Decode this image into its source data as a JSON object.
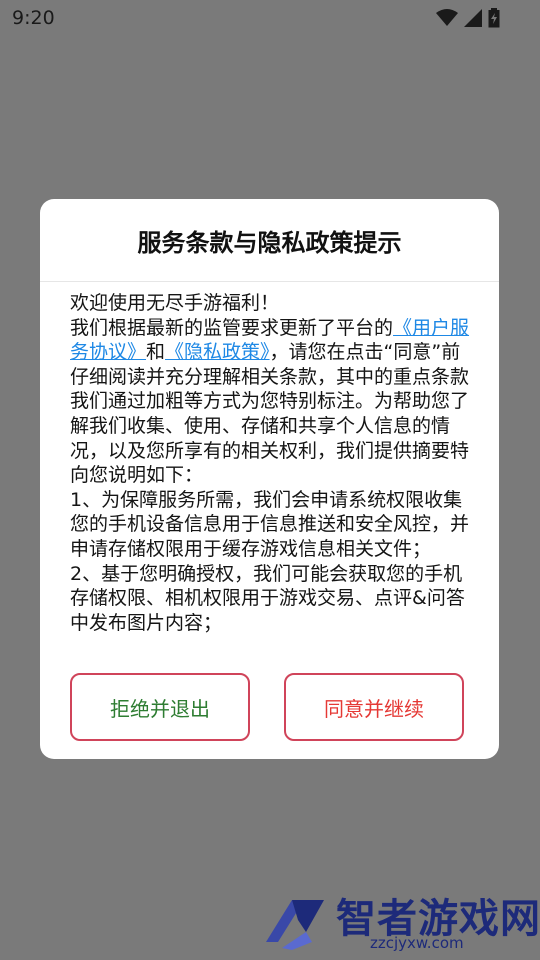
{
  "status_bar": {
    "time": "9:20",
    "icons": [
      "wifi-icon",
      "signal-icon",
      "battery-charging-icon"
    ]
  },
  "dialog": {
    "title": "服务条款与隐私政策提示",
    "greeting": "欢迎使用无尽手游福利！",
    "para1_before": "我们根据最新的监管要求更新了平台的",
    "link_user_agreement": "《用户服务协议》",
    "conjunction": "和",
    "link_privacy_policy": "《隐私政策》",
    "para1_after": "，请您在点击“同意”前仔细阅读并充分理解相关条款，其中的重点条款我们通过加粗等方式为您特别标注。为帮助您了解我们收集、使用、存储和共享个人信息的情况，以及您所享有的相关权利，我们提供摘要特向您说明如下：",
    "item1": "1、为保障服务所需，我们会申请系统权限收集您的手机设备信息用于信息推送和安全风控，并申请存储权限用于缓存游戏信息相关文件；",
    "item2": "2、基于您明确授权，我们可能会获取您的手机存储权限、相机权限用于游戏交易、点评&问答中发布图片内容；",
    "reject_label": "拒绝并退出",
    "agree_label": "同意并继续"
  },
  "watermark": {
    "brand": "智者游戏网",
    "url": "zzcjyxw.com"
  },
  "colors": {
    "overlay": "#7a7a7a",
    "link": "#1e88e5",
    "button_border": "#d0445a",
    "reject_text": "#2e7d32",
    "agree_text": "#e53935"
  }
}
